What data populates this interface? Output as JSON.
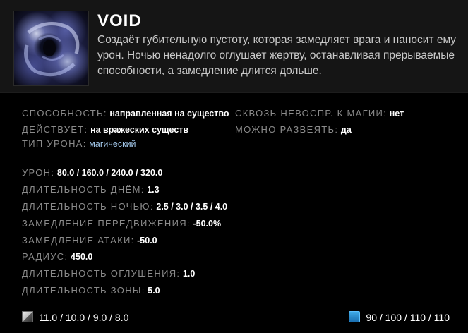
{
  "ability": {
    "name": "VOID",
    "description": "Создаёт губительную пустоту, которая замедляет врага и наносит ему урон. Ночью ненадолго оглушает жертву, останавливая прерываемые способности, а замедление длится дольше.",
    "icon": "void-swirl-icon"
  },
  "properties": {
    "ability": {
      "label": "СПОСОБНОСТЬ:",
      "value": "направленная на существо"
    },
    "affects": {
      "label": "ДЕЙСТВУЕТ:",
      "value": "на вражеских существ"
    },
    "damage_type": {
      "label": "ТИП УРОНА:",
      "value": "магический"
    },
    "pierces_immunity": {
      "label": "СКВОЗЬ НЕВОСПР. К МАГИИ:",
      "value": "нет"
    },
    "dispellable": {
      "label": "МОЖНО РАЗВЕЯТЬ:",
      "value": "да"
    }
  },
  "stats": [
    {
      "label": "УРОН:",
      "value": "80.0 / 160.0 / 240.0 / 320.0"
    },
    {
      "label": "ДЛИТЕЛЬНОСТЬ ДНЁМ:",
      "value": "1.3"
    },
    {
      "label": "ДЛИТЕЛЬНОСТЬ НОЧЬЮ:",
      "value": "2.5 / 3.0 / 3.5 / 4.0"
    },
    {
      "label": "ЗАМЕДЛЕНИЕ ПЕРЕДВИЖЕНИЯ:",
      "value": "-50.0%"
    },
    {
      "label": "ЗАМЕДЛЕНИЕ АТАКИ:",
      "value": "-50.0"
    },
    {
      "label": "РАДИУС:",
      "value": "450.0"
    },
    {
      "label": "ДЛИТЕЛЬНОСТЬ ОГЛУШЕНИЯ:",
      "value": "1.0"
    },
    {
      "label": "ДЛИТЕЛЬНОСТЬ ЗОНЫ:",
      "value": "5.0"
    }
  ],
  "footer": {
    "cooldown": {
      "icon": "cooldown-icon",
      "value": "11.0 / 10.0 / 9.0 / 8.0"
    },
    "mana": {
      "icon": "mana-icon",
      "value": "90 / 100 / 110 / 110"
    }
  },
  "colors": {
    "header_bg": "#151515",
    "body_bg": "#000000",
    "label": "#8a8a8a",
    "value": "#ffffff",
    "magic_value": "#9fc4e6",
    "mana": "#2b8fd0"
  }
}
